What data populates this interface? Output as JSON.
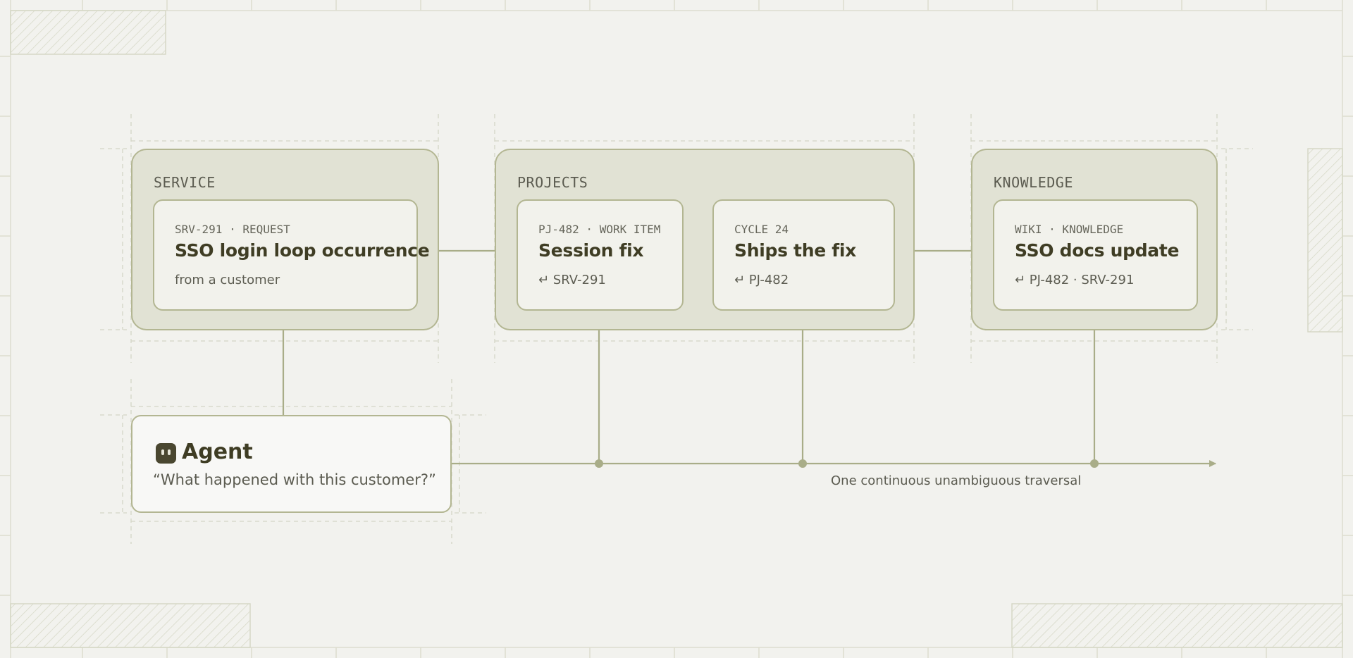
{
  "groups": {
    "service": {
      "label": "SERVICE",
      "card": {
        "meta": "SRV-291 · REQUEST",
        "title": "SSO login loop occurrence",
        "sub": "from a customer"
      }
    },
    "projects": {
      "label": "PROJECTS",
      "cards": [
        {
          "meta": "PJ-482 · WORK ITEM",
          "title": "Session fix",
          "sub": "↵ SRV-291"
        },
        {
          "meta": "CYCLE 24",
          "title": "Ships the fix",
          "sub": "↵ PJ-482"
        }
      ]
    },
    "knowledge": {
      "label": "KNOWLEDGE",
      "card": {
        "meta": "WIKI · KNOWLEDGE",
        "title": "SSO docs update",
        "sub": "↵  PJ-482 · SRV-291"
      }
    }
  },
  "agent": {
    "icon": "robot-face-icon",
    "title": "Agent",
    "quote": "“What happened with this customer?”"
  },
  "caption": "One continuous unambiguous traversal",
  "colors": {
    "background": "#f2f2ee",
    "group_fill": "#e1e2d4",
    "accent_line": "#b3b692",
    "title_text": "#3f3d24"
  }
}
